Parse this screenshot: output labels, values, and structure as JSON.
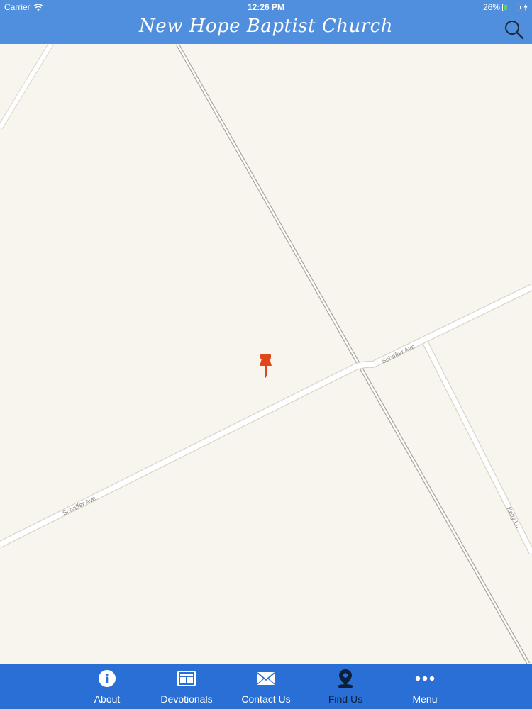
{
  "status_bar": {
    "carrier": "Carrier",
    "time": "12:26 PM",
    "battery_percent": "26%",
    "battery_level": 0.26
  },
  "header": {
    "title": "New Hope Baptist Church",
    "search_icon": "search-icon"
  },
  "map": {
    "road_labels": [
      "Schaffer Ave",
      "Schaffer Ave",
      "Kelly Ln"
    ],
    "pin_color": "#e0461b"
  },
  "tabbar": {
    "tabs": [
      {
        "label": "About",
        "icon": "info-icon"
      },
      {
        "label": "Devotionals",
        "icon": "newspaper-icon"
      },
      {
        "label": "Contact Us",
        "icon": "envelope-icon"
      },
      {
        "label": "Find Us",
        "icon": "location-pin-icon",
        "active": true
      },
      {
        "label": "Menu",
        "icon": "more-icon"
      }
    ],
    "active_color": "#0b1f3a",
    "background": "#2a6fd6"
  },
  "colors": {
    "header_bg": "#4f8fdd",
    "map_bg": "#f8f4ee"
  }
}
